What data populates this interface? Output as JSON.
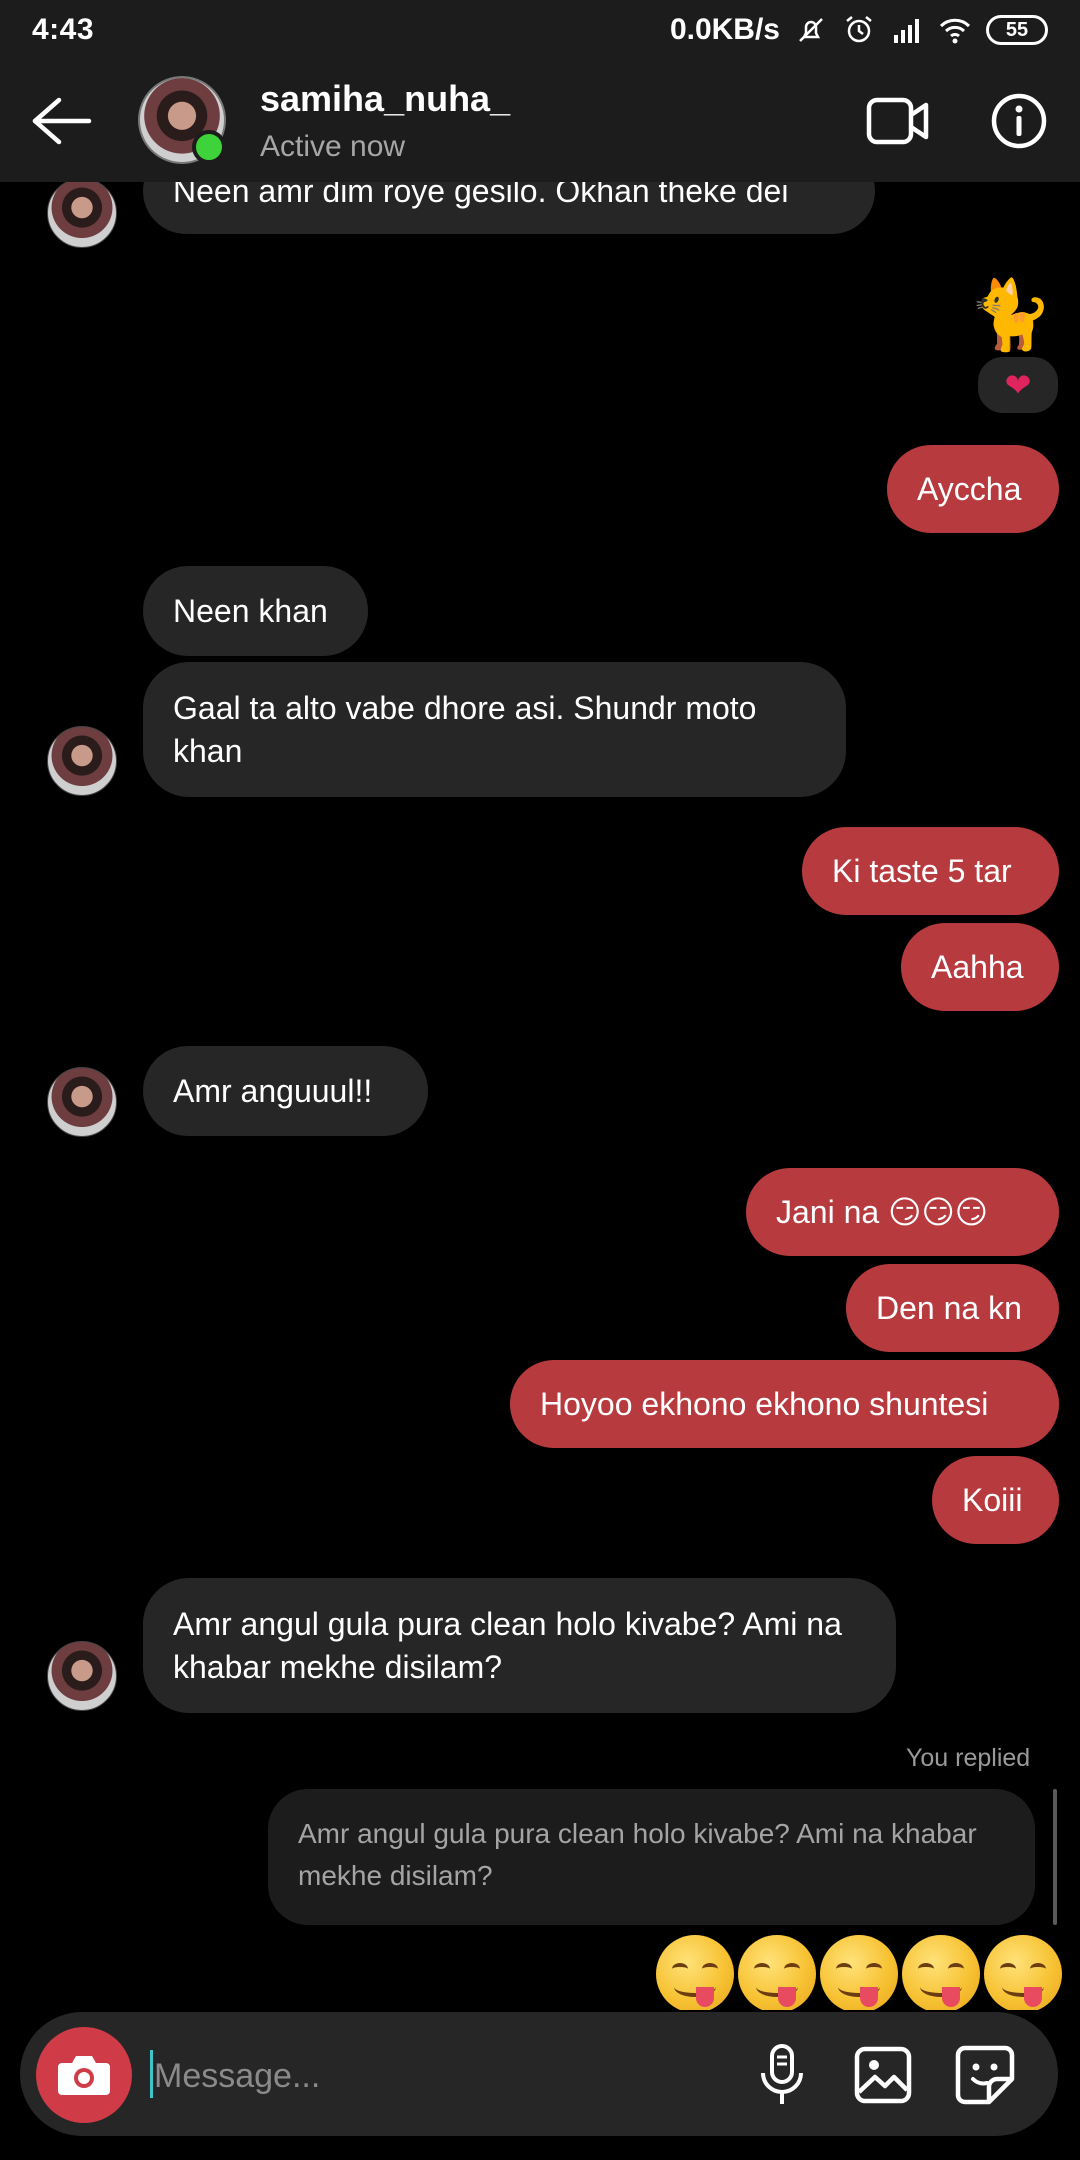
{
  "status_bar": {
    "time": "4:43",
    "network_speed": "0.0KB/s",
    "battery": "55",
    "icons": [
      "mute-icon",
      "alarm-icon",
      "signal-icon",
      "wifi-icon",
      "battery-icon"
    ]
  },
  "header": {
    "contact_name": "samiha_nuha_",
    "contact_status": "Active now",
    "icons": [
      "back-arrow-icon",
      "video-call-icon",
      "info-icon"
    ],
    "presence_color": "#3fd33b"
  },
  "messages": [
    {
      "side": "in",
      "text": "Neen amr dim roye gesilo. Okhan theke dei"
    },
    {
      "side": "out",
      "text": "🐈",
      "type": "sticker",
      "reaction": "❤"
    },
    {
      "side": "out",
      "text": "Ayccha"
    },
    {
      "side": "in",
      "text": "Neen khan"
    },
    {
      "side": "in",
      "text": "Gaal ta alto vabe dhore asi. Shundr moto khan"
    },
    {
      "side": "out",
      "text": "Ki taste 5 tar"
    },
    {
      "side": "out",
      "text": "Aahha"
    },
    {
      "side": "in",
      "text": "Amr anguuul!!"
    },
    {
      "side": "out",
      "text": "Jani na 😏😏😏"
    },
    {
      "side": "out",
      "text": "Den na kn"
    },
    {
      "side": "out",
      "text": "Hoyoo ekhono ekhono shuntesi"
    },
    {
      "side": "out",
      "text": "Koiii"
    },
    {
      "side": "in",
      "text": "Amr angul gula pura clean holo kivabe? Ami na khabar mekhe disilam?"
    }
  ],
  "reply": {
    "label": "You replied",
    "quoted_text": "Amr angul gula pura clean holo kivabe? Ami na khabar mekhe disilam?",
    "emoji_count": 5,
    "emoji_name": "face-savoring-food-emoji"
  },
  "composer": {
    "placeholder": "Message...",
    "icons": [
      "camera-icon",
      "microphone-icon",
      "gallery-icon",
      "sticker-icon"
    ]
  },
  "colors": {
    "outgoing_bubble": "#b73a3f",
    "incoming_bubble": "#262626",
    "camera_button": "#cf3b47"
  }
}
